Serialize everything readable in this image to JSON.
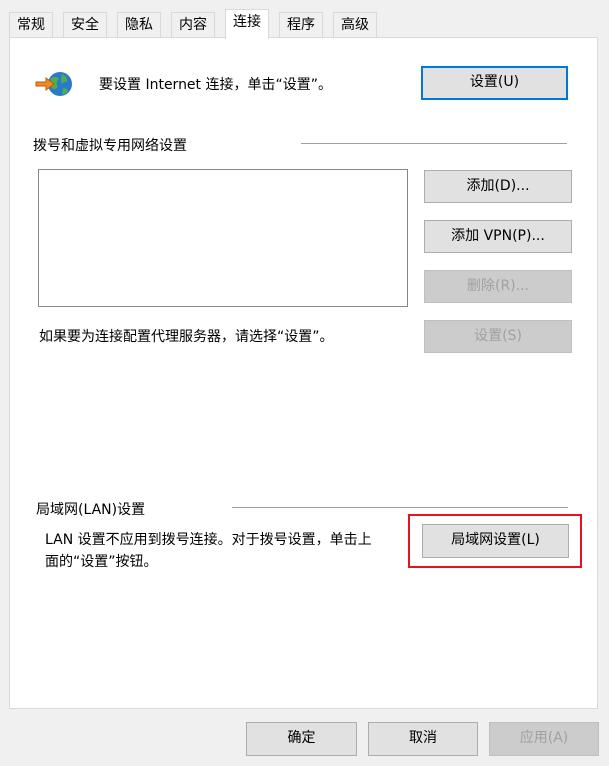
{
  "tabs": [
    {
      "label": "常规"
    },
    {
      "label": "安全"
    },
    {
      "label": "隐私"
    },
    {
      "label": "内容"
    },
    {
      "label": "连接",
      "active": true
    },
    {
      "label": "程序"
    },
    {
      "label": "高级"
    }
  ],
  "internet": {
    "text": "要设置 Internet 连接，单击“设置”。",
    "button": "设置(U)",
    "icon": "internet-connection-icon"
  },
  "dialup": {
    "heading": "拨号和虚拟专用网络设置",
    "add_button": "添加(D)...",
    "add_vpn_button": "添加 VPN(P)...",
    "remove_button": "删除(R)...",
    "settings_button": "设置(S)",
    "proxy_text": "如果要为连接配置代理服务器，请选择“设置”。"
  },
  "lan": {
    "heading": "局域网(LAN)设置",
    "description_line1": "LAN 设置不应用到拨号连接。对于拨号设置，单击上",
    "description_line2": "面的“设置”按钮。",
    "button": "局域网设置(L)",
    "highlight_color": "#e81123"
  },
  "footer": {
    "ok": "确定",
    "cancel": "取消",
    "apply": "应用(A)"
  }
}
